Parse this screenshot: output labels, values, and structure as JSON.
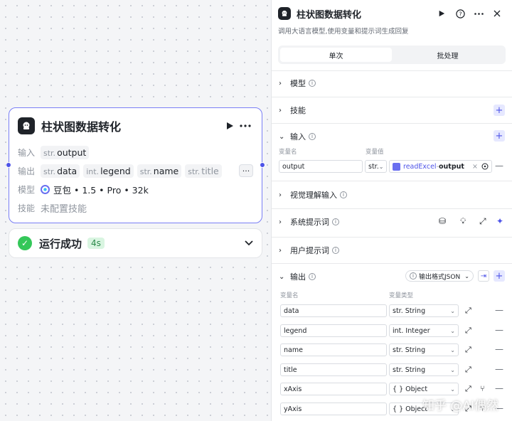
{
  "node": {
    "title": "柱状图数据转化",
    "input_label": "输入",
    "output_label": "输出",
    "model_label": "模型",
    "skill_label": "技能",
    "inputs": [
      {
        "type": "str.",
        "name": "output"
      }
    ],
    "outputs": [
      {
        "type": "str.",
        "name": "data"
      },
      {
        "type": "int.",
        "name": "legend"
      },
      {
        "type": "str.",
        "name": "name"
      },
      {
        "type": "str.",
        "name": "title"
      }
    ],
    "more_glyph": "···",
    "model_value": "豆包 • 1.5 • Pro • 32k",
    "skill_value": "未配置技能"
  },
  "run_status": {
    "text": "运行成功",
    "duration": "4s"
  },
  "panel": {
    "title": "柱状图数据转化",
    "description": "调用大语言模型,使用变量和提示词生成回复",
    "tabs": [
      "单次",
      "批处理"
    ],
    "sections": {
      "model": "模型",
      "skills": "技能",
      "input": "输入",
      "visual_input": "视觉理解输入",
      "system_prompt": "系统提示词",
      "user_prompt": "用户提示词",
      "output": "输出"
    },
    "input_table": {
      "col_name": "变量名",
      "col_value": "变量值",
      "row": {
        "name": "output",
        "type": "str.",
        "ref_node": "readExcel",
        "ref_sep": " - ",
        "ref_var": "output"
      }
    },
    "output_format": "输出格式JSON",
    "output_table": {
      "col_name": "变量名",
      "col_type": "变量类型",
      "rows": [
        {
          "name": "data",
          "type": "str. String"
        },
        {
          "name": "legend",
          "type": "int. Integer"
        },
        {
          "name": "name",
          "type": "str. String"
        },
        {
          "name": "title",
          "type": "str. String"
        },
        {
          "name": "xAxis",
          "type": "{ } Object"
        },
        {
          "name": "yAxis",
          "type": "{ } Object"
        }
      ]
    }
  },
  "watermark": "知乎 @AI偶然",
  "colors": {
    "accent": "#4d53e8",
    "success": "#34c759",
    "node_border": "#7a7ff5"
  }
}
